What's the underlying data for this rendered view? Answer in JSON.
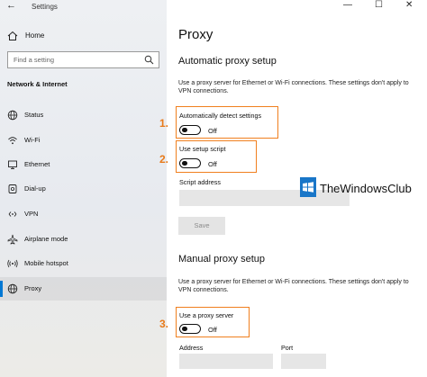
{
  "window": {
    "title": "Settings",
    "back_glyph": "←",
    "minimize_glyph": "—",
    "maximize_glyph": "☐",
    "close_glyph": "✕"
  },
  "sidebar": {
    "home_label": "Home",
    "search_placeholder": "Find a setting",
    "section_header": "Network & Internet",
    "items": [
      {
        "label": "Status",
        "icon": "globe-status-icon"
      },
      {
        "label": "Wi-Fi",
        "icon": "wifi-icon"
      },
      {
        "label": "Ethernet",
        "icon": "ethernet-icon"
      },
      {
        "label": "Dial-up",
        "icon": "dialup-icon"
      },
      {
        "label": "VPN",
        "icon": "vpn-icon"
      },
      {
        "label": "Airplane mode",
        "icon": "airplane-icon"
      },
      {
        "label": "Mobile hotspot",
        "icon": "hotspot-icon"
      },
      {
        "label": "Proxy",
        "icon": "globe-icon",
        "selected": true
      }
    ]
  },
  "main": {
    "page_title": "Proxy",
    "automatic": {
      "heading": "Automatic proxy setup",
      "description": "Use a proxy server for Ethernet or Wi-Fi connections. These settings don't apply to VPN connections.",
      "auto_detect_label": "Automatically detect settings",
      "auto_detect_state": "Off",
      "script_label": "Use setup script",
      "script_state": "Off",
      "script_address_label": "Script address",
      "script_address_value": "",
      "save_label": "Save"
    },
    "manual": {
      "heading": "Manual proxy setup",
      "description": "Use a proxy server for Ethernet or Wi-Fi connections. These settings don't apply to VPN connections.",
      "use_proxy_label": "Use a proxy server",
      "use_proxy_state": "Off",
      "address_label": "Address",
      "address_value": "",
      "port_label": "Port",
      "port_value": ""
    }
  },
  "annotations": {
    "marker1": "1.",
    "marker2": "2.",
    "marker3": "3.",
    "color": "#f07f1e"
  },
  "watermark": {
    "text": "TheWindowsClub"
  },
  "colors": {
    "accent": "#0078d4",
    "highlight": "#f07f1e"
  }
}
